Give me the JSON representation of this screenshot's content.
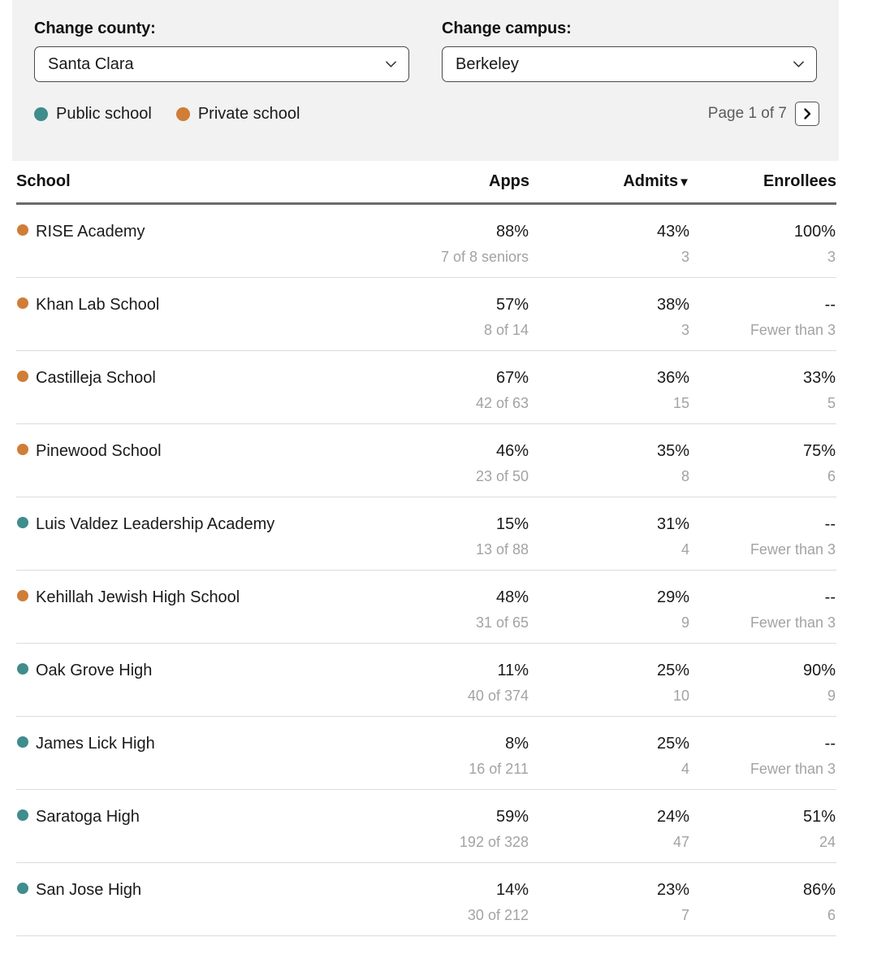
{
  "controls": {
    "county": {
      "label": "Change county:",
      "value": "Santa Clara"
    },
    "campus": {
      "label": "Change campus:",
      "value": "Berkeley"
    }
  },
  "legend": {
    "items": [
      {
        "label": "Public school",
        "color": "#3f8d8c",
        "type": "public"
      },
      {
        "label": "Private school",
        "color": "#d07d37",
        "type": "private"
      }
    ]
  },
  "pagination": {
    "text": "Page 1 of 7",
    "next_icon": "chevron-right-icon"
  },
  "icons": {
    "select_chevron": "chevron-down-icon"
  },
  "table": {
    "columns": [
      {
        "key": "school",
        "label": "School",
        "align": "left"
      },
      {
        "key": "apps",
        "label": "Apps",
        "align": "right"
      },
      {
        "key": "admits",
        "label": "Admits",
        "align": "right",
        "sorted": true,
        "sort_caret": "▼"
      },
      {
        "key": "enrollees",
        "label": "Enrollees",
        "align": "right"
      }
    ],
    "rows": [
      {
        "school": "RISE Academy",
        "type": "private",
        "apps": "88%",
        "apps_sub": "7 of 8 seniors",
        "admits": "43%",
        "admits_sub": "3",
        "enrollees": "100%",
        "enrollees_sub": "3"
      },
      {
        "school": "Khan Lab School",
        "type": "private",
        "apps": "57%",
        "apps_sub": "8 of 14",
        "admits": "38%",
        "admits_sub": "3",
        "enrollees": "--",
        "enrollees_sub": "Fewer than 3"
      },
      {
        "school": "Castilleja School",
        "type": "private",
        "apps": "67%",
        "apps_sub": "42 of 63",
        "admits": "36%",
        "admits_sub": "15",
        "enrollees": "33%",
        "enrollees_sub": "5"
      },
      {
        "school": "Pinewood School",
        "type": "private",
        "apps": "46%",
        "apps_sub": "23 of 50",
        "admits": "35%",
        "admits_sub": "8",
        "enrollees": "75%",
        "enrollees_sub": "6"
      },
      {
        "school": "Luis Valdez Leadership Academy",
        "type": "public",
        "apps": "15%",
        "apps_sub": "13 of 88",
        "admits": "31%",
        "admits_sub": "4",
        "enrollees": "--",
        "enrollees_sub": "Fewer than 3"
      },
      {
        "school": "Kehillah Jewish High School",
        "type": "private",
        "apps": "48%",
        "apps_sub": "31 of 65",
        "admits": "29%",
        "admits_sub": "9",
        "enrollees": "--",
        "enrollees_sub": "Fewer than 3"
      },
      {
        "school": "Oak Grove High",
        "type": "public",
        "apps": "11%",
        "apps_sub": "40 of 374",
        "admits": "25%",
        "admits_sub": "10",
        "enrollees": "90%",
        "enrollees_sub": "9"
      },
      {
        "school": "James Lick High",
        "type": "public",
        "apps": "8%",
        "apps_sub": "16 of 211",
        "admits": "25%",
        "admits_sub": "4",
        "enrollees": "--",
        "enrollees_sub": "Fewer than 3"
      },
      {
        "school": "Saratoga High",
        "type": "public",
        "apps": "59%",
        "apps_sub": "192 of 328",
        "admits": "24%",
        "admits_sub": "47",
        "enrollees": "51%",
        "enrollees_sub": "24"
      },
      {
        "school": "San Jose High",
        "type": "public",
        "apps": "14%",
        "apps_sub": "30 of 212",
        "admits": "23%",
        "admits_sub": "7",
        "enrollees": "86%",
        "enrollees_sub": "6"
      }
    ]
  },
  "colors": {
    "public": "#3f8d8c",
    "private": "#d07d37",
    "panel_bg": "#f2f2f2",
    "header_rule": "#6b6b6b",
    "row_rule": "#dcdcdc",
    "muted_text": "#a3a3a3"
  }
}
